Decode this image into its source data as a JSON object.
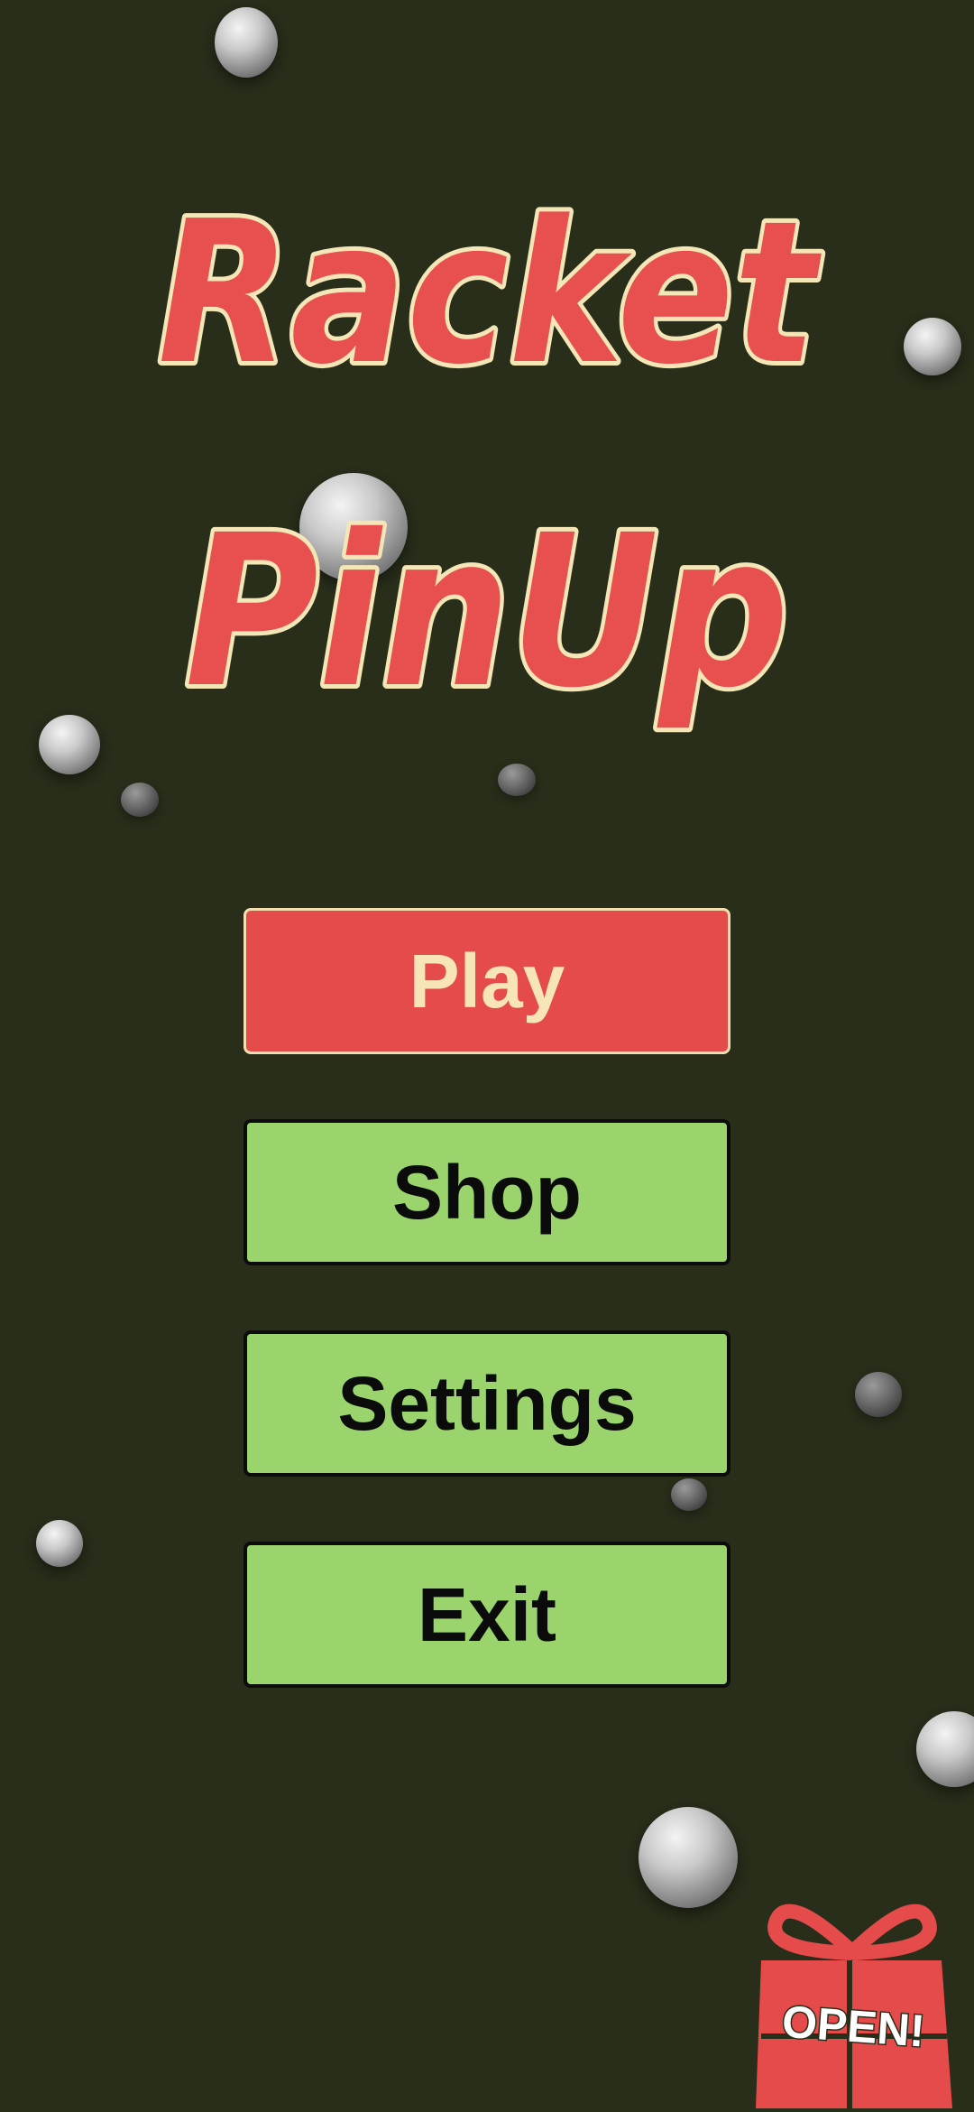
{
  "game": {
    "title_line1": "Racket",
    "title_line2": "PinUp"
  },
  "menu": {
    "play_label": "Play",
    "shop_label": "Shop",
    "settings_label": "Settings",
    "exit_label": "Exit"
  },
  "gift": {
    "label": "OPEN!",
    "icon": "gift-box-icon"
  },
  "colors": {
    "background": "#282e1a",
    "title_fill": "#e85050",
    "title_outline": "#f5e6b8",
    "play_button": "#e54b4b",
    "menu_button": "#9bd46c"
  }
}
